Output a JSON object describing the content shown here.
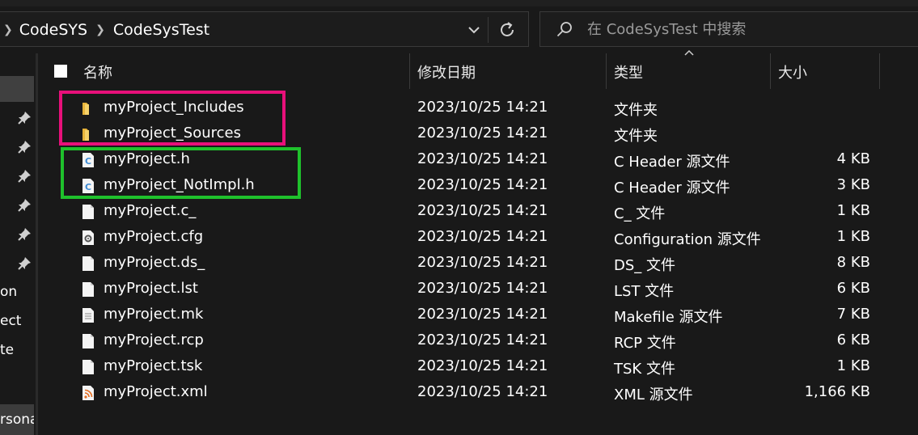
{
  "address_bar": {
    "breadcrumbs": [
      "CodeSYS",
      "CodeSysTest"
    ]
  },
  "search": {
    "placeholder": "在 CodeSysTest 中搜索"
  },
  "sidebar": {
    "partial_labels": [
      "on",
      "ect",
      "te",
      "rsona"
    ]
  },
  "columns": {
    "name": "名称",
    "date": "修改日期",
    "type": "类型",
    "size": "大小"
  },
  "files": [
    {
      "name": "myProject_Includes",
      "date": "2023/10/25 14:21",
      "type": "文件夹",
      "size": "",
      "icon": "folder-icon"
    },
    {
      "name": "myProject_Sources",
      "date": "2023/10/25 14:21",
      "type": "文件夹",
      "size": "",
      "icon": "folder-icon"
    },
    {
      "name": "myProject.h",
      "date": "2023/10/25 14:21",
      "type": "C Header 源文件",
      "size": "4 KB",
      "icon": "c-header-file-icon"
    },
    {
      "name": "myProject_NotImpl.h",
      "date": "2023/10/25 14:21",
      "type": "C Header 源文件",
      "size": "3 KB",
      "icon": "c-header-file-icon"
    },
    {
      "name": "myProject.c_",
      "date": "2023/10/25 14:21",
      "type": "C_ 文件",
      "size": "1 KB",
      "icon": "file-icon"
    },
    {
      "name": "myProject.cfg",
      "date": "2023/10/25 14:21",
      "type": "Configuration 源文件",
      "size": "1 KB",
      "icon": "config-file-icon"
    },
    {
      "name": "myProject.ds_",
      "date": "2023/10/25 14:21",
      "type": "DS_ 文件",
      "size": "8 KB",
      "icon": "file-icon"
    },
    {
      "name": "myProject.lst",
      "date": "2023/10/25 14:21",
      "type": "LST 文件",
      "size": "6 KB",
      "icon": "file-icon"
    },
    {
      "name": "myProject.mk",
      "date": "2023/10/25 14:21",
      "type": "Makefile 源文件",
      "size": "7 KB",
      "icon": "text-file-icon"
    },
    {
      "name": "myProject.rcp",
      "date": "2023/10/25 14:21",
      "type": "RCP 文件",
      "size": "6 KB",
      "icon": "file-icon"
    },
    {
      "name": "myProject.tsk",
      "date": "2023/10/25 14:21",
      "type": "TSK 文件",
      "size": "1 KB",
      "icon": "file-icon"
    },
    {
      "name": "myProject.xml",
      "date": "2023/10/25 14:21",
      "type": "XML 源文件",
      "size": "1,166 KB",
      "icon": "xml-file-icon"
    }
  ],
  "colors": {
    "background": "#191919",
    "highlight_pink": "#e8107a",
    "highlight_green": "#1fc12c",
    "folder": "#f3c54a",
    "c_header_icon": "#3d8bd4"
  }
}
